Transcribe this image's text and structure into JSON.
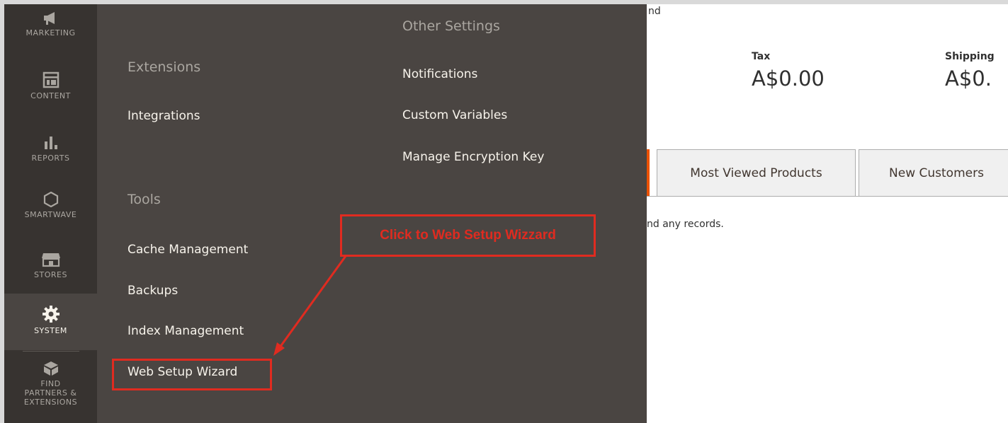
{
  "sidebar": {
    "items": [
      {
        "label": "MARKETING",
        "icon": "megaphone-icon"
      },
      {
        "label": "CONTENT",
        "icon": "layout-icon"
      },
      {
        "label": "REPORTS",
        "icon": "bar-chart-icon"
      },
      {
        "label": "SMARTWAVE",
        "icon": "hexagon-icon"
      },
      {
        "label": "STORES",
        "icon": "storefront-icon"
      },
      {
        "label": "SYSTEM",
        "icon": "gear-icon"
      },
      {
        "label": "FIND PARTNERS & EXTENSIONS",
        "icon": "cube-icon"
      }
    ]
  },
  "flyout": {
    "extensions": {
      "title": "Extensions",
      "items": [
        "Integrations"
      ]
    },
    "tools": {
      "title": "Tools",
      "items": [
        "Cache Management",
        "Backups",
        "Index Management",
        "Web Setup Wizard"
      ]
    },
    "other": {
      "title": "Other Settings",
      "items": [
        "Notifications",
        "Custom Variables",
        "Manage Encryption Key"
      ]
    }
  },
  "dashboard": {
    "frag_top": "nd",
    "tax_label": "Tax",
    "tax_value": "A$0.00",
    "shipping_label": "Shipping",
    "shipping_value": "A$0.",
    "tabs": [
      "Most Viewed Products",
      "New Customers"
    ],
    "empty_msg": "nd any records."
  },
  "annotation": {
    "text": "Click to Web Setup Wizzard",
    "color": "#e02b20"
  }
}
